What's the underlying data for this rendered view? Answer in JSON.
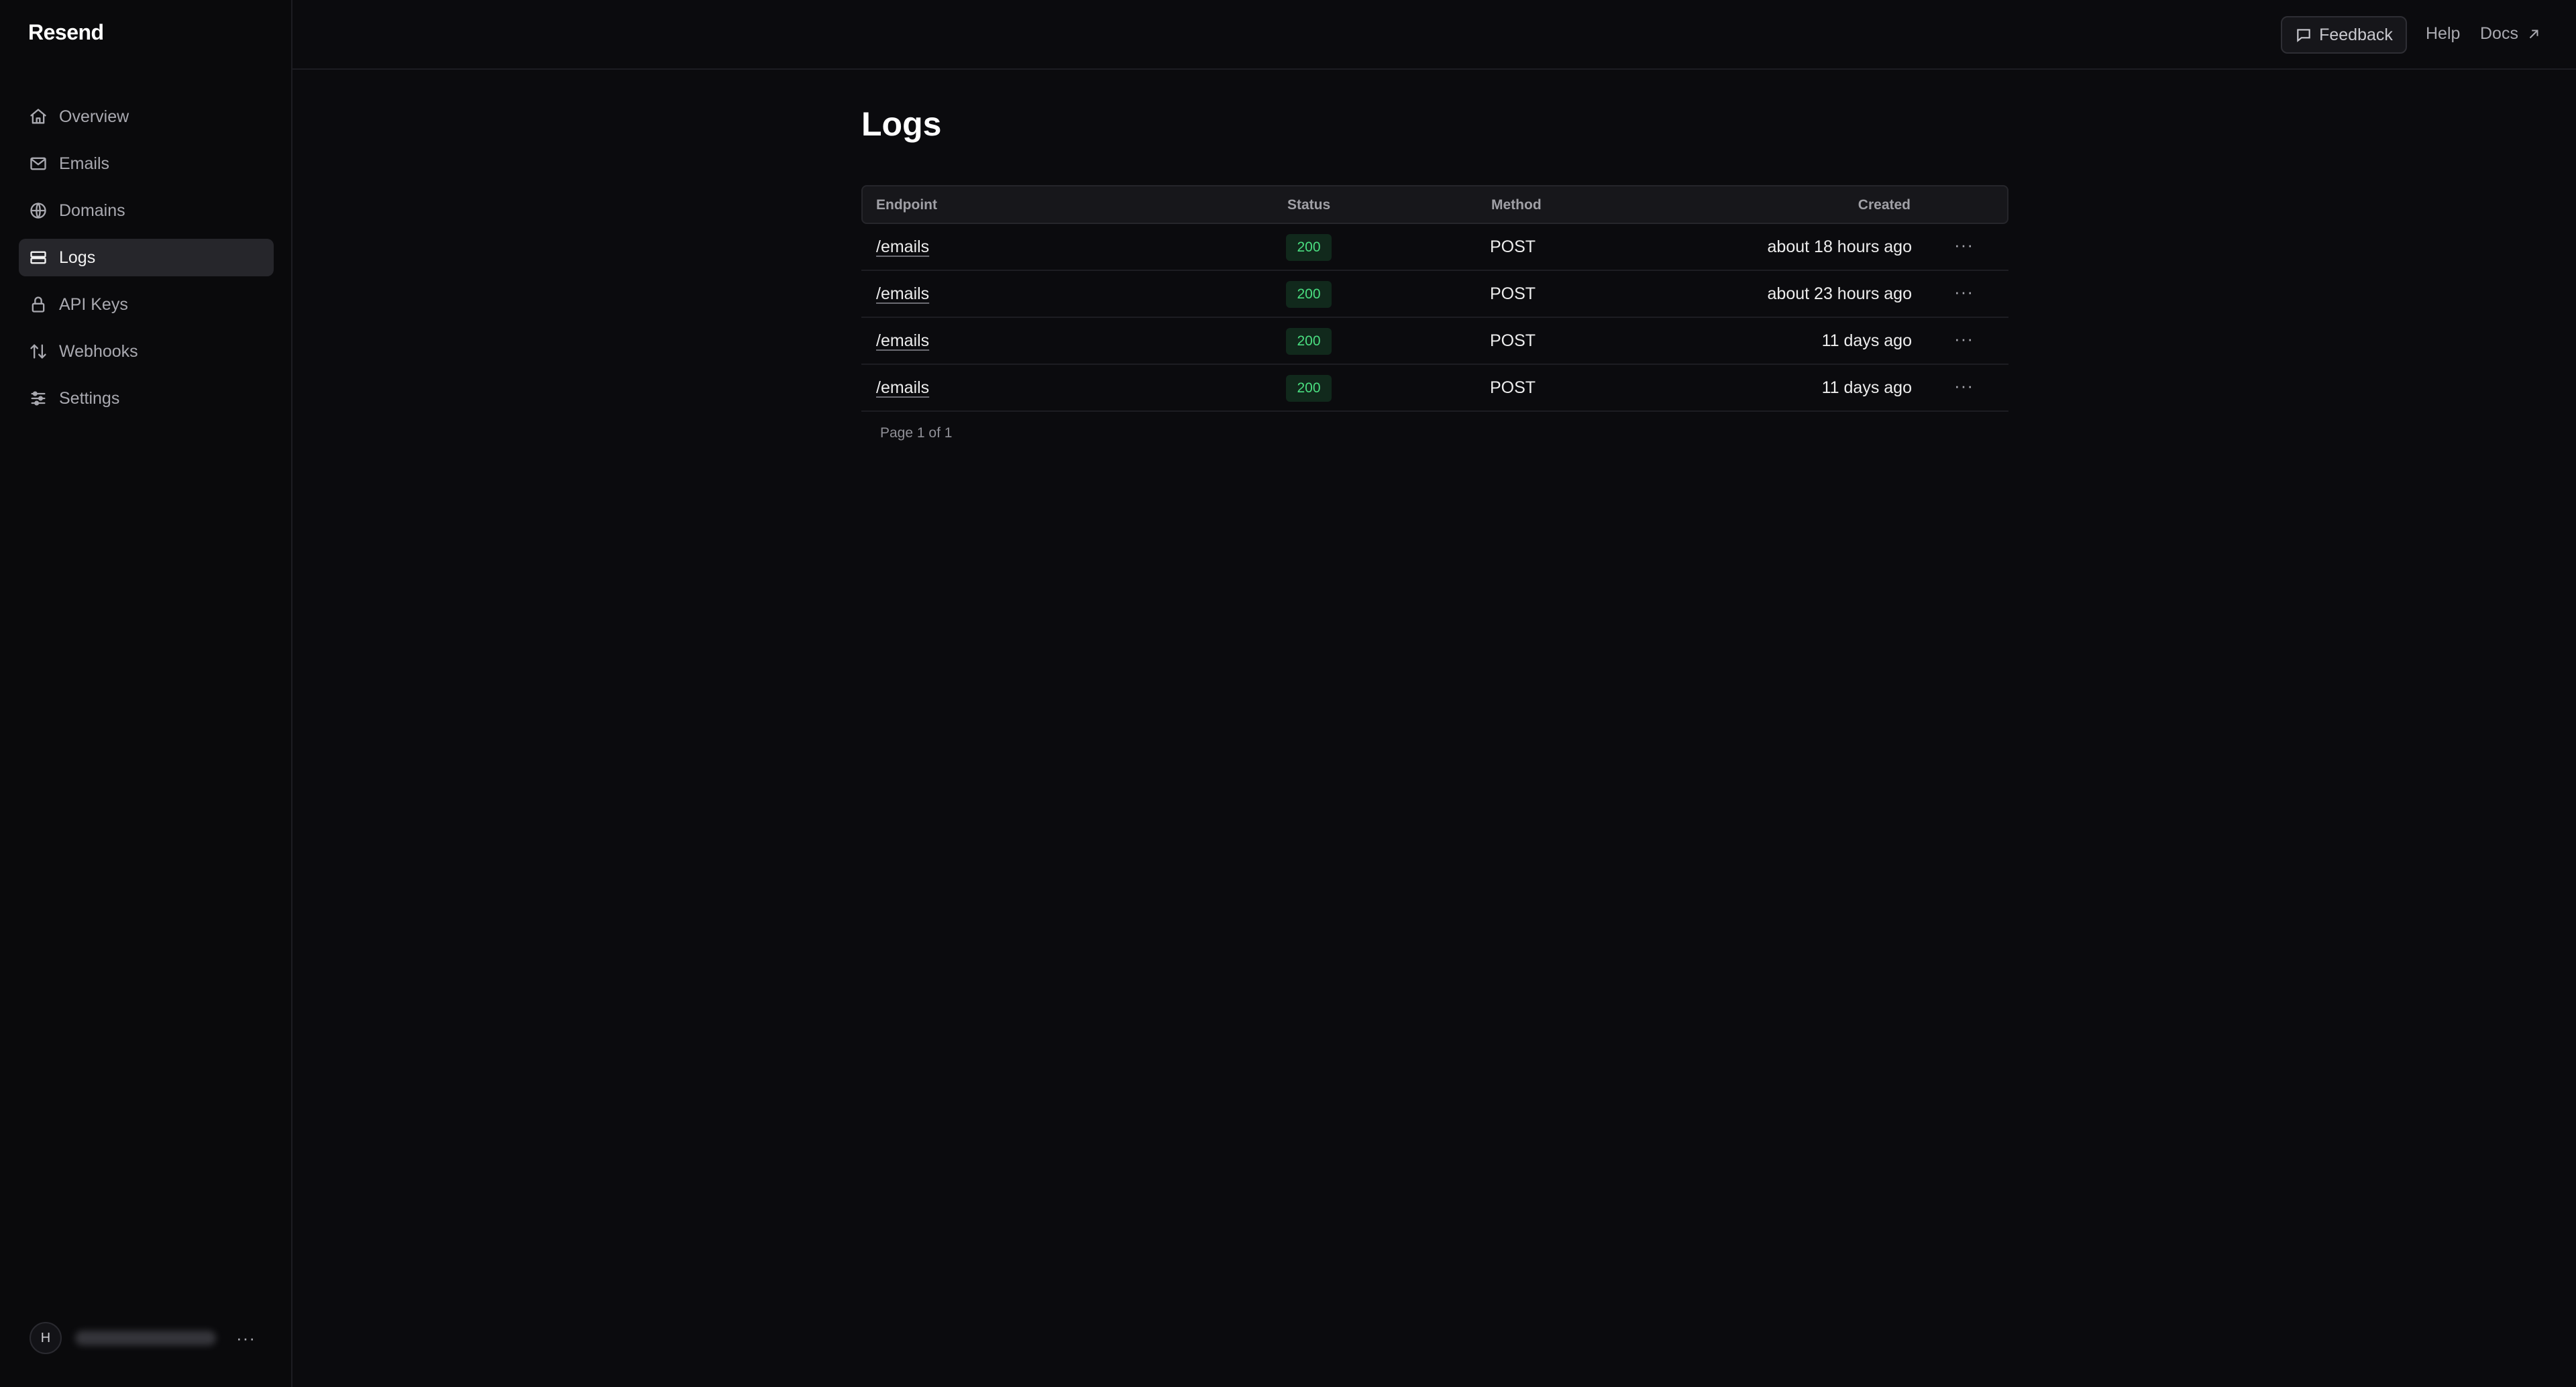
{
  "app": {
    "name": "Resend"
  },
  "sidebar": {
    "items": [
      {
        "label": "Overview",
        "icon": "home-icon",
        "active": false
      },
      {
        "label": "Emails",
        "icon": "mail-icon",
        "active": false
      },
      {
        "label": "Domains",
        "icon": "globe-icon",
        "active": false
      },
      {
        "label": "Logs",
        "icon": "logs-icon",
        "active": true
      },
      {
        "label": "API Keys",
        "icon": "lock-icon",
        "active": false
      },
      {
        "label": "Webhooks",
        "icon": "webhook-icon",
        "active": false
      },
      {
        "label": "Settings",
        "icon": "sliders-icon",
        "active": false
      }
    ]
  },
  "account": {
    "avatar_initial": "H",
    "more": "···"
  },
  "header": {
    "feedback_label": "Feedback",
    "help_label": "Help",
    "docs_label": "Docs"
  },
  "main": {
    "title": "Logs",
    "table": {
      "columns": [
        "Endpoint",
        "Status",
        "Method",
        "Created"
      ],
      "rows": [
        {
          "endpoint": "/emails",
          "status": "200",
          "method": "POST",
          "created": "about 18 hours ago"
        },
        {
          "endpoint": "/emails",
          "status": "200",
          "method": "POST",
          "created": "about 23 hours ago"
        },
        {
          "endpoint": "/emails",
          "status": "200",
          "method": "POST",
          "created": "11 days ago"
        },
        {
          "endpoint": "/emails",
          "status": "200",
          "method": "POST",
          "created": "11 days ago"
        }
      ],
      "row_more": "···"
    },
    "pagination": "Page 1 of 1"
  },
  "colors": {
    "background": "#0b0b0e",
    "status_success_bg": "#11291c",
    "status_success_text": "#4ade80",
    "active_nav_bg": "#26262b"
  }
}
